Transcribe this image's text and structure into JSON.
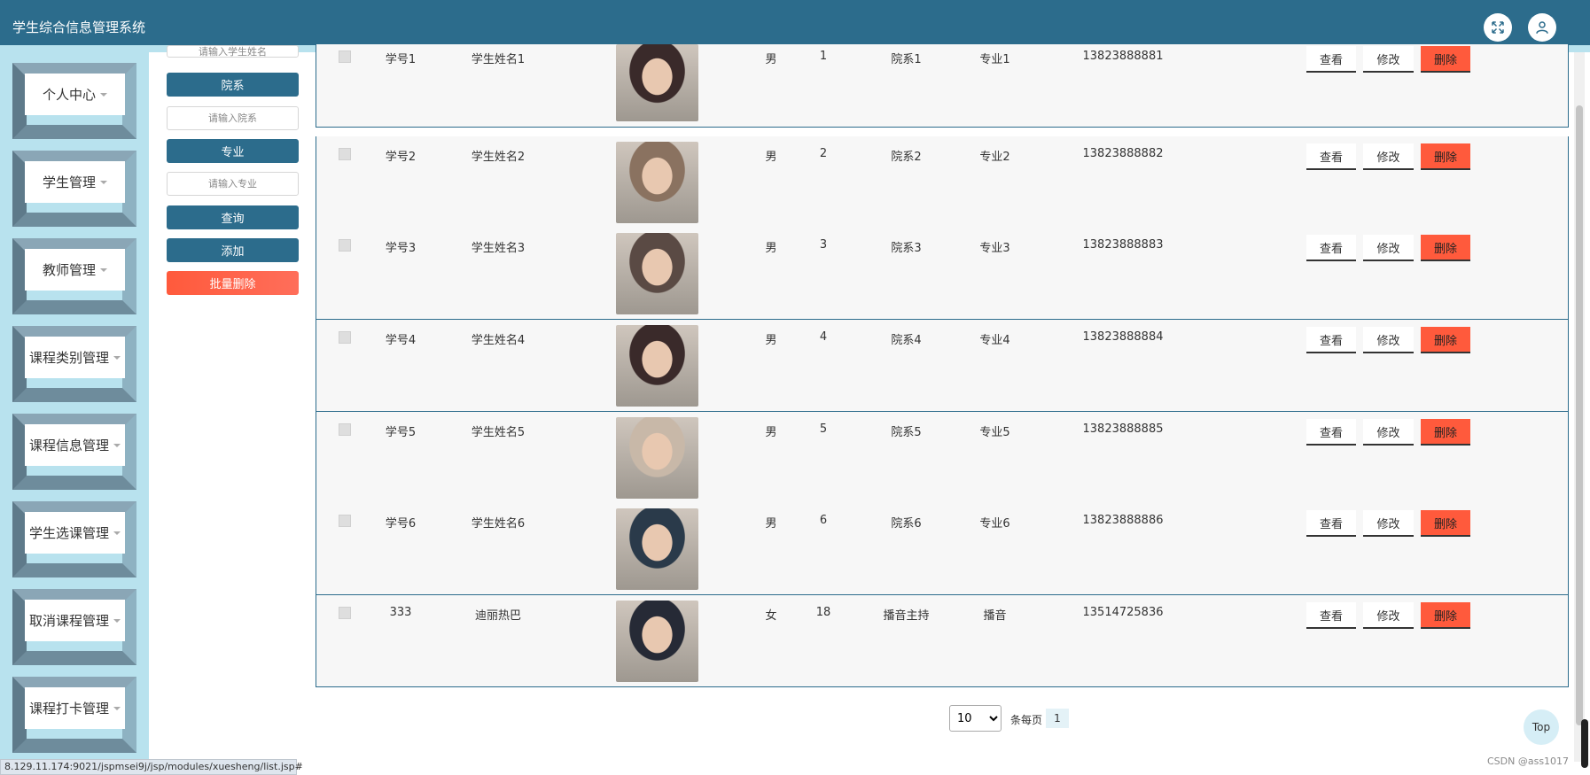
{
  "header": {
    "title": "学生综合信息管理系统",
    "bg_color": "#2c6c8c",
    "accent_color": "#b8e2ee",
    "icons": [
      "fullscreen-icon",
      "user-icon"
    ]
  },
  "sidebar": {
    "items": [
      {
        "label": "个人中心"
      },
      {
        "label": "学生管理"
      },
      {
        "label": "教师管理"
      },
      {
        "label": "课程类别管理"
      },
      {
        "label": "课程信息管理"
      },
      {
        "label": "学生选课管理"
      },
      {
        "label": "取消课程管理"
      },
      {
        "label": "课程打卡管理"
      }
    ]
  },
  "search": {
    "name_placeholder": "请输入学生姓名",
    "dept_label": "院系",
    "dept_placeholder": "请输入院系",
    "major_label": "专业",
    "major_placeholder": "请输入专业",
    "query_label": "查询",
    "add_label": "添加",
    "batch_delete_label": "批量删除"
  },
  "table": {
    "actions": {
      "view": "查看",
      "edit": "修改",
      "delete": "删除"
    },
    "rows": [
      {
        "id": "学号1",
        "name": "学生姓名1",
        "gender": "男",
        "age": "1",
        "dept": "院系1",
        "major": "专业1",
        "phone": "13823888881",
        "photo_color": "#3a2a2a"
      },
      {
        "id": "学号2",
        "name": "学生姓名2",
        "gender": "男",
        "age": "2",
        "dept": "院系2",
        "major": "专业2",
        "phone": "13823888882",
        "photo_color": "#8a7260"
      },
      {
        "id": "学号3",
        "name": "学生姓名3",
        "gender": "男",
        "age": "3",
        "dept": "院系3",
        "major": "专业3",
        "phone": "13823888883",
        "photo_color": "#5a4a44"
      },
      {
        "id": "学号4",
        "name": "学生姓名4",
        "gender": "男",
        "age": "4",
        "dept": "院系4",
        "major": "专业4",
        "phone": "13823888884",
        "photo_color": "#3a2a2a"
      },
      {
        "id": "学号5",
        "name": "学生姓名5",
        "gender": "男",
        "age": "5",
        "dept": "院系5",
        "major": "专业5",
        "phone": "13823888885",
        "photo_color": "#c8b8a8"
      },
      {
        "id": "学号6",
        "name": "学生姓名6",
        "gender": "男",
        "age": "6",
        "dept": "院系6",
        "major": "专业6",
        "phone": "13823888886",
        "photo_color": "#2a3a4a"
      },
      {
        "id": "333",
        "name": "迪丽热巴",
        "gender": "女",
        "age": "18",
        "dept": "播音主持",
        "major": "播音",
        "phone": "13514725836",
        "photo_color": "#262a36"
      }
    ]
  },
  "pager": {
    "page_size": "10",
    "page_size_options": [
      "10"
    ],
    "per_page_label": "条每页",
    "current_page": "1",
    "top_label": "Top"
  },
  "statusbar": {
    "url": "8.129.11.174:9021/jspmsei9j/jsp/modules/xuesheng/list.jsp#"
  },
  "watermark": "CSDN @ass1017"
}
